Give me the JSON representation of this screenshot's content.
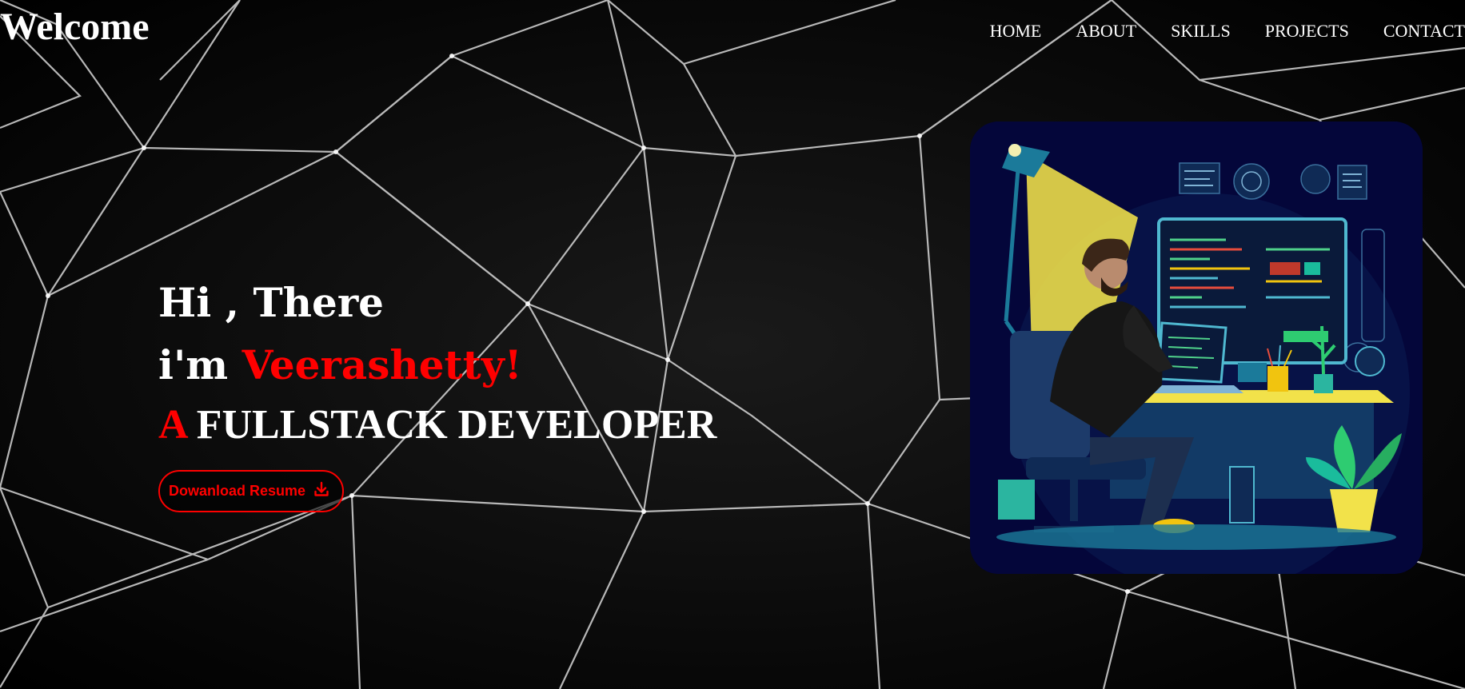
{
  "header": {
    "brand": "Welcome",
    "nav": [
      "HOME",
      "ABOUT",
      "SKILLS",
      "PROJECTS",
      "CONTACT"
    ]
  },
  "hero": {
    "greeting": "Hi , There",
    "intro_prefix": "i'm ",
    "name": "Veerashetty!",
    "role_prefix": "A",
    "role": "FULLSTACK DEVELOPER",
    "resume_button": "Dowanload Resume"
  },
  "icons": {
    "resume": "download-icon",
    "illustration": "developer-at-desk-illustration"
  },
  "colors": {
    "background": "#000000",
    "text": "#ffffff",
    "accent": "#ff0000",
    "illustration_bg": "#04063a"
  }
}
